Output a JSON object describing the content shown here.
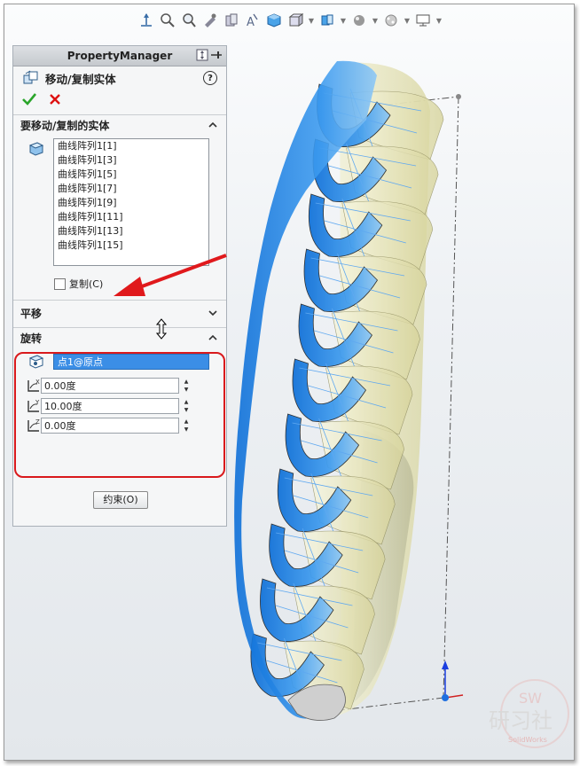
{
  "property_manager": {
    "header": "PropertyManager",
    "feature_title": "移动/复制实体",
    "help": "?",
    "sections": {
      "bodies": {
        "title": "要移动/复制的实体",
        "items": [
          "曲线阵列1[1]",
          "曲线阵列1[3]",
          "曲线阵列1[5]",
          "曲线阵列1[7]",
          "曲线阵列1[9]",
          "曲线阵列1[11]",
          "曲线阵列1[13]",
          "曲线阵列1[15]"
        ],
        "copy_label": "复制(C)",
        "copy_checked": false
      },
      "translate": {
        "title": "平移"
      },
      "rotate": {
        "title": "旋转",
        "point": "点1@原点",
        "x_angle": "0.00度",
        "y_angle": "10.00度",
        "z_angle": "0.00度",
        "x_label": "X",
        "y_label": "Y",
        "z_label": "Z"
      }
    },
    "constraint_button": "约束(O)"
  },
  "watermark": {
    "sw": "SW",
    "text": "研习社",
    "sub": "SolidWorks"
  },
  "colors": {
    "accent_blue": "#3b8ee6",
    "highlight_red": "#d9191c",
    "body_blue": "#1e7fe0",
    "body_yellow": "#f2efb8"
  }
}
